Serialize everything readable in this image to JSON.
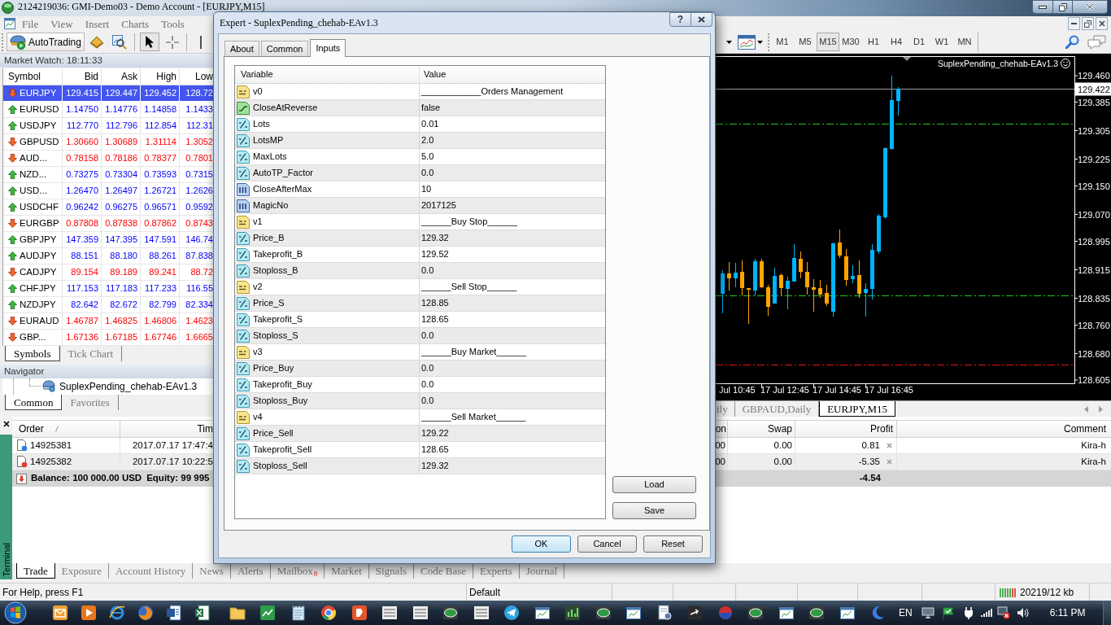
{
  "window": {
    "title": "2124219036: GMI-Demo03 - Demo Account - [EURJPY,M15]"
  },
  "menu": [
    "File",
    "View",
    "Insert",
    "Charts",
    "Tools"
  ],
  "toolbar": {
    "autotrading": "AutoTrading",
    "timeframes": [
      {
        "label": "M1",
        "selected": false
      },
      {
        "label": "M5",
        "selected": false
      },
      {
        "label": "M15",
        "selected": true
      },
      {
        "label": "M30",
        "selected": false
      },
      {
        "label": "H1",
        "selected": false
      },
      {
        "label": "H4",
        "selected": false
      },
      {
        "label": "D1",
        "selected": false
      },
      {
        "label": "W1",
        "selected": false
      },
      {
        "label": "MN",
        "selected": false
      }
    ]
  },
  "market_watch": {
    "title": "Market Watch: 18:11:33",
    "columns": [
      "Symbol",
      "Bid",
      "Ask",
      "High",
      "Low"
    ],
    "rows": [
      {
        "symbol": "EURJPY",
        "bid": "129.415",
        "ask": "129.447",
        "high": "129.452",
        "low": "128.72",
        "rising": false,
        "selected": true
      },
      {
        "symbol": "EURUSD",
        "bid": "1.14750",
        "ask": "1.14776",
        "high": "1.14858",
        "low": "1.1433",
        "rising": true,
        "selected": false
      },
      {
        "symbol": "USDJPY",
        "bid": "112.770",
        "ask": "112.796",
        "high": "112.854",
        "low": "112.31",
        "rising": true,
        "selected": false
      },
      {
        "symbol": "GBPUSD",
        "bid": "1.30660",
        "ask": "1.30689",
        "high": "1.31114",
        "low": "1.3052",
        "rising": false,
        "selected": false
      },
      {
        "symbol": "AUD...",
        "bid": "0.78158",
        "ask": "0.78186",
        "high": "0.78377",
        "low": "0.7801",
        "rising": false,
        "selected": false
      },
      {
        "symbol": "NZD...",
        "bid": "0.73275",
        "ask": "0.73304",
        "high": "0.73593",
        "low": "0.7315",
        "rising": true,
        "selected": false
      },
      {
        "symbol": "USD...",
        "bid": "1.26470",
        "ask": "1.26497",
        "high": "1.26721",
        "low": "1.2626",
        "rising": true,
        "selected": false
      },
      {
        "symbol": "USDCHF",
        "bid": "0.96242",
        "ask": "0.96275",
        "high": "0.96571",
        "low": "0.9592",
        "rising": true,
        "selected": false
      },
      {
        "symbol": "EURGBP",
        "bid": "0.87808",
        "ask": "0.87838",
        "high": "0.87862",
        "low": "0.8743",
        "rising": false,
        "selected": false
      },
      {
        "symbol": "GBPJPY",
        "bid": "147.359",
        "ask": "147.395",
        "high": "147.591",
        "low": "146.74",
        "rising": true,
        "selected": false
      },
      {
        "symbol": "AUDJPY",
        "bid": "88.151",
        "ask": "88.180",
        "high": "88.261",
        "low": "87.838",
        "rising": true,
        "selected": false
      },
      {
        "symbol": "CADJPY",
        "bid": "89.154",
        "ask": "89.189",
        "high": "89.241",
        "low": "88.72",
        "rising": false,
        "selected": false
      },
      {
        "symbol": "CHFJPY",
        "bid": "117.153",
        "ask": "117.183",
        "high": "117.233",
        "low": "116.55",
        "rising": true,
        "selected": false
      },
      {
        "symbol": "NZDJPY",
        "bid": "82.642",
        "ask": "82.672",
        "high": "82.799",
        "low": "82.334",
        "rising": true,
        "selected": false
      },
      {
        "symbol": "EURAUD",
        "bid": "1.46787",
        "ask": "1.46825",
        "high": "1.46806",
        "low": "1.4623",
        "rising": false,
        "selected": false
      },
      {
        "symbol": "GBP...",
        "bid": "1.67136",
        "ask": "1.67185",
        "high": "1.67746",
        "low": "1.6665",
        "rising": false,
        "selected": false
      }
    ],
    "tabs": [
      {
        "label": "Symbols",
        "selected": true
      },
      {
        "label": "Tick Chart",
        "selected": false
      }
    ]
  },
  "navigator": {
    "title": "Navigator",
    "items": [
      "SuplexPending_chehab-EAv1.3"
    ],
    "tabs": [
      {
        "label": "Common",
        "selected": true
      },
      {
        "label": "Favorites",
        "selected": false
      }
    ]
  },
  "chart": {
    "indicator": "SuplexPending_chehab-EAv1.3",
    "price_labels": [
      "129.460",
      "129.385",
      "129.305",
      "129.225",
      "129.150",
      "129.070",
      "128.995",
      "128.915",
      "128.835",
      "128.760",
      "128.680",
      "128.605"
    ],
    "current_price": "129.422",
    "time_labels": [
      "Jul 10:45",
      "17 Jul 12:45",
      "17 Jul 14:45",
      "17 Jul 16:45"
    ]
  },
  "chart_tabs": [
    {
      "label": "ily",
      "selected": false
    },
    {
      "label": "GBPAUD,Daily",
      "selected": false
    },
    {
      "label": "EURJPY,M15",
      "selected": true
    }
  ],
  "terminal": {
    "title": "Terminal",
    "columns": [
      "Order",
      "Tim",
      "on",
      "Swap",
      "Profit",
      "Comment"
    ],
    "rows": [
      {
        "order": "14925381",
        "time": "2017.07.17 17:47:4",
        "column_3": "00",
        "swap": "0.00",
        "profit": "0.81",
        "comment": "Kira-h",
        "color": "#2d7fe0"
      },
      {
        "order": "14925382",
        "time": "2017.07.17 10:22:5",
        "column_3": "00",
        "swap": "0.00",
        "profit": "-5.35",
        "comment": "Kira-h",
        "color": "#e0402a"
      }
    ],
    "balance": {
      "balance": "Balance: 100 000.00 USD",
      "equity": "Equity: 99 995",
      "profit": "-4.54"
    },
    "tabs": [
      {
        "label": "Trade",
        "selected": true
      },
      {
        "label": "Exposure",
        "selected": false
      },
      {
        "label": "Account History",
        "selected": false
      },
      {
        "label": "News",
        "selected": false
      },
      {
        "label": "Alerts",
        "selected": false
      },
      {
        "label": "Mailbox",
        "badge": "8",
        "selected": false
      },
      {
        "label": "Market",
        "selected": false
      },
      {
        "label": "Signals",
        "selected": false
      },
      {
        "label": "Code Base",
        "selected": false
      },
      {
        "label": "Experts",
        "selected": false
      },
      {
        "label": "Journal",
        "selected": false
      }
    ]
  },
  "status_bar": {
    "help": "For Help, press F1",
    "profile": "Default",
    "traffic": "20219/12 kb"
  },
  "taskbar": {
    "language": "EN",
    "clock": "6:11 PM"
  },
  "dialog": {
    "title": "Expert - SuplexPending_chehab-EAv1.3",
    "help": "?",
    "tabs": [
      {
        "label": "About",
        "selected": false
      },
      {
        "label": "Common",
        "selected": false
      },
      {
        "label": "Inputs",
        "selected": true
      }
    ],
    "columns": [
      "Variable",
      "Value"
    ],
    "rows": [
      {
        "kind": "string",
        "variable": "v0",
        "value": "____________Orders Management"
      },
      {
        "kind": "bool",
        "variable": "CloseAtReverse",
        "value": "false"
      },
      {
        "kind": "double",
        "variable": "Lots",
        "value": "0.01"
      },
      {
        "kind": "double",
        "variable": "LotsMP",
        "value": "2.0"
      },
      {
        "kind": "double",
        "variable": "MaxLots",
        "value": "5.0"
      },
      {
        "kind": "double",
        "variable": "AutoTP_Factor",
        "value": "0.0"
      },
      {
        "kind": "int",
        "variable": "CloseAfterMax",
        "value": "10"
      },
      {
        "kind": "int",
        "variable": "MagicNo",
        "value": "2017125"
      },
      {
        "kind": "string",
        "variable": "v1",
        "value": "______Buy Stop______"
      },
      {
        "kind": "double",
        "variable": "Price_B",
        "value": "129.32"
      },
      {
        "kind": "double",
        "variable": "Takeprofit_B",
        "value": "129.52"
      },
      {
        "kind": "double",
        "variable": "Stoploss_B",
        "value": "0.0"
      },
      {
        "kind": "string",
        "variable": "v2",
        "value": "______Sell Stop______"
      },
      {
        "kind": "double",
        "variable": "Price_S",
        "value": "128.85"
      },
      {
        "kind": "double",
        "variable": "Takeprofit_S",
        "value": "128.65"
      },
      {
        "kind": "double",
        "variable": "Stoploss_S",
        "value": "0.0"
      },
      {
        "kind": "string",
        "variable": "v3",
        "value": "______Buy Market______"
      },
      {
        "kind": "double",
        "variable": "Price_Buy",
        "value": "0.0"
      },
      {
        "kind": "double",
        "variable": "Takeprofit_Buy",
        "value": "0.0"
      },
      {
        "kind": "double",
        "variable": "Stoploss_Buy",
        "value": "0.0"
      },
      {
        "kind": "string",
        "variable": "v4",
        "value": "______Sell Market______"
      },
      {
        "kind": "double",
        "variable": "Price_Sell",
        "value": "129.22"
      },
      {
        "kind": "double",
        "variable": "Takeprofit_Sell",
        "value": "128.65"
      },
      {
        "kind": "double",
        "variable": "Stoploss_Sell",
        "value": "129.32"
      }
    ],
    "side_buttons": [
      "Load",
      "Save"
    ],
    "buttons": [
      {
        "label": "OK",
        "default": true
      },
      {
        "label": "Cancel",
        "default": false
      },
      {
        "label": "Reset",
        "default": false
      }
    ]
  }
}
